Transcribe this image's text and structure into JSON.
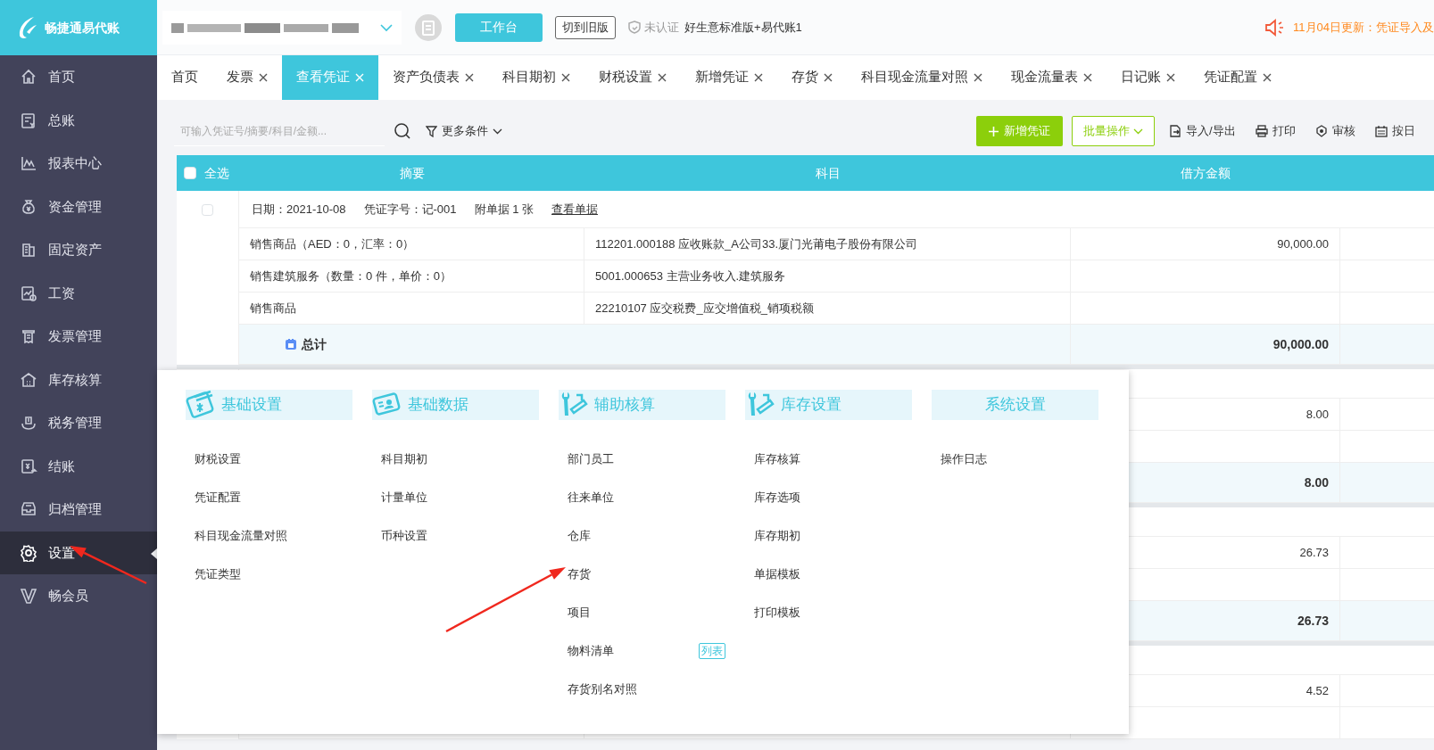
{
  "app": {
    "logo_text": "畅捷通易代账"
  },
  "sidebar": {
    "items": [
      {
        "label": "首页",
        "selected": false
      },
      {
        "label": "总账",
        "selected": false
      },
      {
        "label": "报表中心",
        "selected": false
      },
      {
        "label": "资金管理",
        "selected": false
      },
      {
        "label": "固定资产",
        "selected": false
      },
      {
        "label": "工资",
        "selected": false
      },
      {
        "label": "发票管理",
        "selected": false
      },
      {
        "label": "库存核算",
        "selected": false
      },
      {
        "label": "税务管理",
        "selected": false
      },
      {
        "label": "结账",
        "selected": false
      },
      {
        "label": "归档管理",
        "selected": false
      },
      {
        "label": "设置",
        "selected": true
      },
      {
        "label": "畅会员",
        "selected": false
      }
    ]
  },
  "topbar": {
    "workbench_button": "工作台",
    "switch_button": "切到旧版",
    "cert_status": "未认证",
    "edition": "好生意标准版+易代账1",
    "notice": "11月04日更新：凭证导入及"
  },
  "tabs": [
    {
      "label": "首页",
      "closable": false,
      "selected": false
    },
    {
      "label": "发票",
      "closable": true,
      "selected": false
    },
    {
      "label": "查看凭证",
      "closable": true,
      "selected": true
    },
    {
      "label": "资产负债表",
      "closable": true,
      "selected": false
    },
    {
      "label": "科目期初",
      "closable": true,
      "selected": false
    },
    {
      "label": "财税设置",
      "closable": true,
      "selected": false
    },
    {
      "label": "新增凭证",
      "closable": true,
      "selected": false
    },
    {
      "label": "存货",
      "closable": true,
      "selected": false
    },
    {
      "label": "科目现金流量对照",
      "closable": true,
      "selected": false
    },
    {
      "label": "现金流量表",
      "closable": true,
      "selected": false
    },
    {
      "label": "日记账",
      "closable": true,
      "selected": false
    },
    {
      "label": "凭证配置",
      "closable": true,
      "selected": false
    }
  ],
  "toolbar": {
    "search": {
      "placeholder": "可输入凭证号/摘要/科目/金额..."
    },
    "filter": "更多条件",
    "buttons": [
      {
        "label": "新增凭证",
        "kind": "primary"
      },
      {
        "label": "批量操作",
        "kind": "outline"
      },
      {
        "label": "导入/导出",
        "kind": "export"
      },
      {
        "label": "打印",
        "kind": "print"
      },
      {
        "label": "审核",
        "kind": "audit"
      },
      {
        "label": "按日",
        "kind": "calendar"
      }
    ]
  },
  "table": {
    "select_all": {
      "label": "全选",
      "checked": false
    },
    "columns": [
      "摘要",
      "科目",
      "借方金额"
    ],
    "vouchers": [
      {
        "checked": false,
        "date": "日期：2021-10-08",
        "number": "凭证字号：记-001",
        "attachments": "附单据 1 张",
        "view_link": "查看单据",
        "rows": [
          {
            "summary": "销售商品（AED：0，汇率：0）",
            "account": "112201.000188  应收账款_A公司33.厦门光莆电子股份有限公司",
            "debit": "90,000.00"
          },
          {
            "summary": "销售建筑服务（数量：0 件，单价：0）",
            "account": "5001.000653  主营业务收入.建筑服务"
          },
          {
            "summary": "销售商品",
            "account": "22210107 应交税费_应交增值税_销项税额"
          }
        ],
        "total_label": "总计",
        "total_debit": "90,000.00"
      },
      {
        "rows": [
          {
            "debit": "8.00"
          },
          {}
        ],
        "total_debit": "8.00"
      },
      {
        "rows": [
          {
            "debit": "26.73"
          },
          {}
        ],
        "total_debit": "26.73"
      },
      {
        "rows": [
          {
            "debit": "4.52"
          },
          {}
        ]
      }
    ]
  },
  "settings_menu": {
    "groups": [
      {
        "title": "基础设置",
        "items": [
          {
            "label": "财税设置"
          },
          {
            "label": "凭证配置"
          },
          {
            "label": "科目现金流量对照"
          },
          {
            "label": "凭证类型"
          }
        ]
      },
      {
        "title": "基础数据",
        "items": [
          {
            "label": "科目期初"
          },
          {
            "label": "计量单位"
          },
          {
            "label": "币种设置"
          }
        ]
      },
      {
        "title": "辅助核算",
        "items": [
          {
            "label": "部门员工"
          },
          {
            "label": "往来单位"
          },
          {
            "label": "仓库"
          },
          {
            "label": "存货"
          },
          {
            "label": "项目"
          },
          {
            "label": "物料清单",
            "tag": "列表"
          },
          {
            "label": "存货别名对照"
          }
        ]
      },
      {
        "title": "库存设置",
        "items": [
          {
            "label": "库存核算"
          },
          {
            "label": "库存选项"
          },
          {
            "label": "库存期初"
          },
          {
            "label": "单据模板"
          },
          {
            "label": "打印模板"
          }
        ]
      },
      {
        "title": "系统设置",
        "items": [
          {
            "label": "操作日志"
          }
        ]
      }
    ]
  }
}
